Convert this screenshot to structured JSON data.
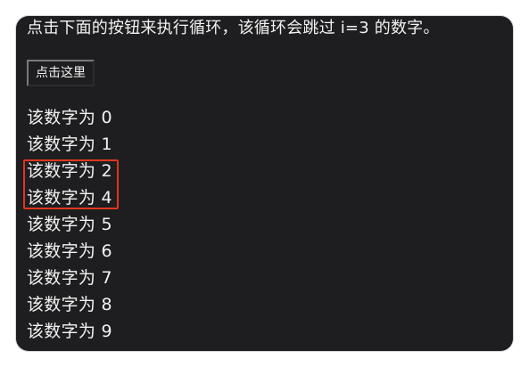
{
  "intro_text": "点击下面的按钮来执行循环，该循环会跳过 i=3 的数字。",
  "button_label": "点击这里",
  "output_lines": [
    "该数字为 0",
    "该数字为 1",
    "该数字为 2",
    "该数字为 4",
    "该数字为 5",
    "该数字为 6",
    "该数字为 7",
    "该数字为 8",
    "该数字为 9"
  ],
  "colors": {
    "panel_background": "#1e1e20",
    "text": "#f2f2f2",
    "highlight_border": "#e0361e"
  }
}
